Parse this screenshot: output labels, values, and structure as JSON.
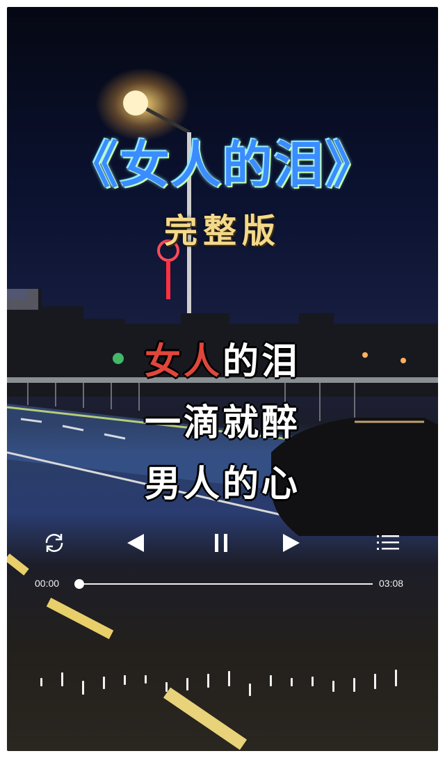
{
  "title": "《女人的泪》",
  "subtitle": "完整版",
  "lyrics": {
    "line1_highlight": "女人",
    "line1_rest": "的泪",
    "line2": "一滴就醉",
    "line3": "男人的心"
  },
  "player": {
    "current_time": "00:00",
    "total_time": "03:08",
    "progress": 0,
    "buttons": [
      "loop-icon",
      "previous-icon",
      "pause-icon",
      "next-icon",
      "playlist-icon"
    ]
  },
  "colors": {
    "title": "#3a8cff",
    "subtitle": "#f4d98a",
    "lyric_highlight": "#e0463c",
    "lyric": "#ffffff"
  }
}
